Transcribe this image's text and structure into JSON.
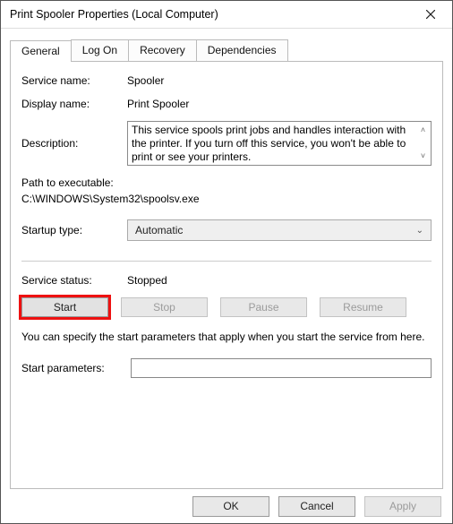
{
  "window": {
    "title": "Print Spooler Properties (Local Computer)"
  },
  "tabs": {
    "general": "General",
    "logon": "Log On",
    "recovery": "Recovery",
    "dependencies": "Dependencies"
  },
  "labels": {
    "service_name": "Service name:",
    "display_name": "Display name:",
    "description": "Description:",
    "path_label": "Path to executable:",
    "startup_type": "Startup type:",
    "service_status": "Service status:",
    "start_parameters": "Start parameters:"
  },
  "values": {
    "service_name": "Spooler",
    "display_name": "Print Spooler",
    "description": "This service spools print jobs and handles interaction with the printer.  If you turn off this service, you won't be able to print or see your printers.",
    "path": "C:\\WINDOWS\\System32\\spoolsv.exe",
    "startup_type": "Automatic",
    "service_status": "Stopped",
    "start_parameters": ""
  },
  "buttons": {
    "start": "Start",
    "stop": "Stop",
    "pause": "Pause",
    "resume": "Resume",
    "ok": "OK",
    "cancel": "Cancel",
    "apply": "Apply"
  },
  "note": "You can specify the start parameters that apply when you start the service from here."
}
